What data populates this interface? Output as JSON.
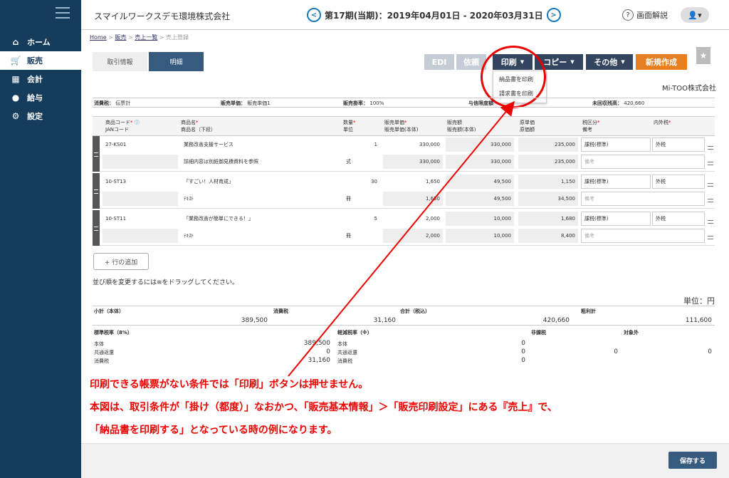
{
  "sidebar": {
    "items": [
      {
        "label": "ホーム",
        "icon": "home-icon"
      },
      {
        "label": "販売",
        "icon": "cart-icon"
      },
      {
        "label": "会計",
        "icon": "calculator-icon"
      },
      {
        "label": "給与",
        "icon": "money-bag-icon"
      },
      {
        "label": "設定",
        "icon": "gear-icon"
      }
    ]
  },
  "header": {
    "company": "スマイルワークスデモ環境株式会社",
    "period": "第17期(当期)：2019年04月01日 - 2020年03月31日",
    "help_label": "画面解説"
  },
  "breadcrumb": {
    "home": "Home",
    "sales": "販売",
    "list": "売上一覧",
    "current": "売上登録",
    "sep": ">"
  },
  "tabs": {
    "info": "取引情報",
    "detail": "明細"
  },
  "toolbar": {
    "edi": "EDI",
    "request": "依頼",
    "print": "印刷",
    "copy": "コピー",
    "other": "その他",
    "new": "新規作成"
  },
  "print_menu": {
    "delivery": "納品書を印刷",
    "invoice": "請求書を印刷"
  },
  "customer": "Mi-TOO株式会社",
  "info": {
    "tax_label": "消費税：",
    "tax_value": "伝票計",
    "price_label": "販売単価：",
    "price_value": "販売単価1",
    "rate_label": "販売掛率：",
    "rate_value": "100%",
    "credit_label": "与信限度額",
    "balance_label": "未回収残高：",
    "balance_value": "420,660"
  },
  "columns": {
    "code1": "商品コード",
    "code2": "JANコード",
    "name1": "商品名",
    "name2": "商品名（下段）",
    "qty1": "数量",
    "qty2": "単位",
    "price1": "販売単価",
    "price2": "販売単価(本体)",
    "amount1": "販売額",
    "amount2": "販売額(本体)",
    "cost1": "原単価",
    "cost2": "原価額",
    "taxcat1": "税区分",
    "taxcat2": "備考",
    "taxtype": "内外税"
  },
  "rows": [
    {
      "code": "27-KS01",
      "name": "業務改善支援サービス",
      "name2": "詳細内容は別紙御見積資料を参照",
      "qty": "1",
      "unit": "式",
      "price": "330,000",
      "price2": "330,000",
      "amount": "330,000",
      "amount2": "330,000",
      "cost": "235,000",
      "cost2": "235,000",
      "taxcat": "課税(標準)",
      "taxtype": "外税",
      "memo": "備考"
    },
    {
      "code": "10-ST13",
      "name": "「すごい！人材育成」",
      "name2": "ﾃｷｽﾄ",
      "qty": "30",
      "unit": "冊",
      "price": "1,650",
      "price2": "1,650",
      "amount": "49,500",
      "amount2": "49,500",
      "cost": "1,150",
      "cost2": "34,500",
      "taxcat": "課税(標準)",
      "taxtype": "外税",
      "memo": "備考"
    },
    {
      "code": "10-ST11",
      "name": "「業務改善が簡単にできる！」",
      "name2": "ﾃｷｽﾄ",
      "qty": "5",
      "unit": "冊",
      "price": "2,000",
      "price2": "2,000",
      "amount": "10,000",
      "amount2": "10,000",
      "cost": "1,680",
      "cost2": "8,400",
      "taxcat": "課税(標準)",
      "taxtype": "外税",
      "memo": "備考"
    }
  ],
  "add_row": "+ 行の追加",
  "drag_note": "並び順を変更するには≡をドラッグしてください。",
  "unit_label": "単位：円",
  "totals": {
    "subtotal_label": "小計（本体）",
    "subtotal": "389,500",
    "tax_label": "消費税",
    "tax": "31,160",
    "total_label": "合計（税込）",
    "total": "420,660",
    "profit_label": "粗利計",
    "profit": "111,600"
  },
  "tax_breakdown": {
    "std_label": "標準税率（8%）",
    "body": "本体",
    "refund": "共通返還",
    "tax": "消費税",
    "std_body": "389,500",
    "std_refund": "0",
    "std_tax": "31,160",
    "red_label": "軽減税率（※）",
    "red_body": "0",
    "red_refund": "0",
    "red_tax": "0",
    "nontax_label": "非課税",
    "nontax": "0",
    "exempt_label": "対象外",
    "exempt": "0"
  },
  "annotation": {
    "line1": "印刷できる帳票がない条件では「印刷」ボタンは押せません。",
    "line2": "本図は、取引条件が「掛け（都度）」なおかつ、「販売基本情報」＞「販売印刷設定」にある『売上』で、",
    "line3": "「納品書を印刷する」となっている時の例になります。"
  },
  "save": "保存する",
  "colors": {
    "sidebar": "#163c5c",
    "accent": "#375a7f",
    "orange": "#e67e22",
    "annotation": "#e00000"
  }
}
